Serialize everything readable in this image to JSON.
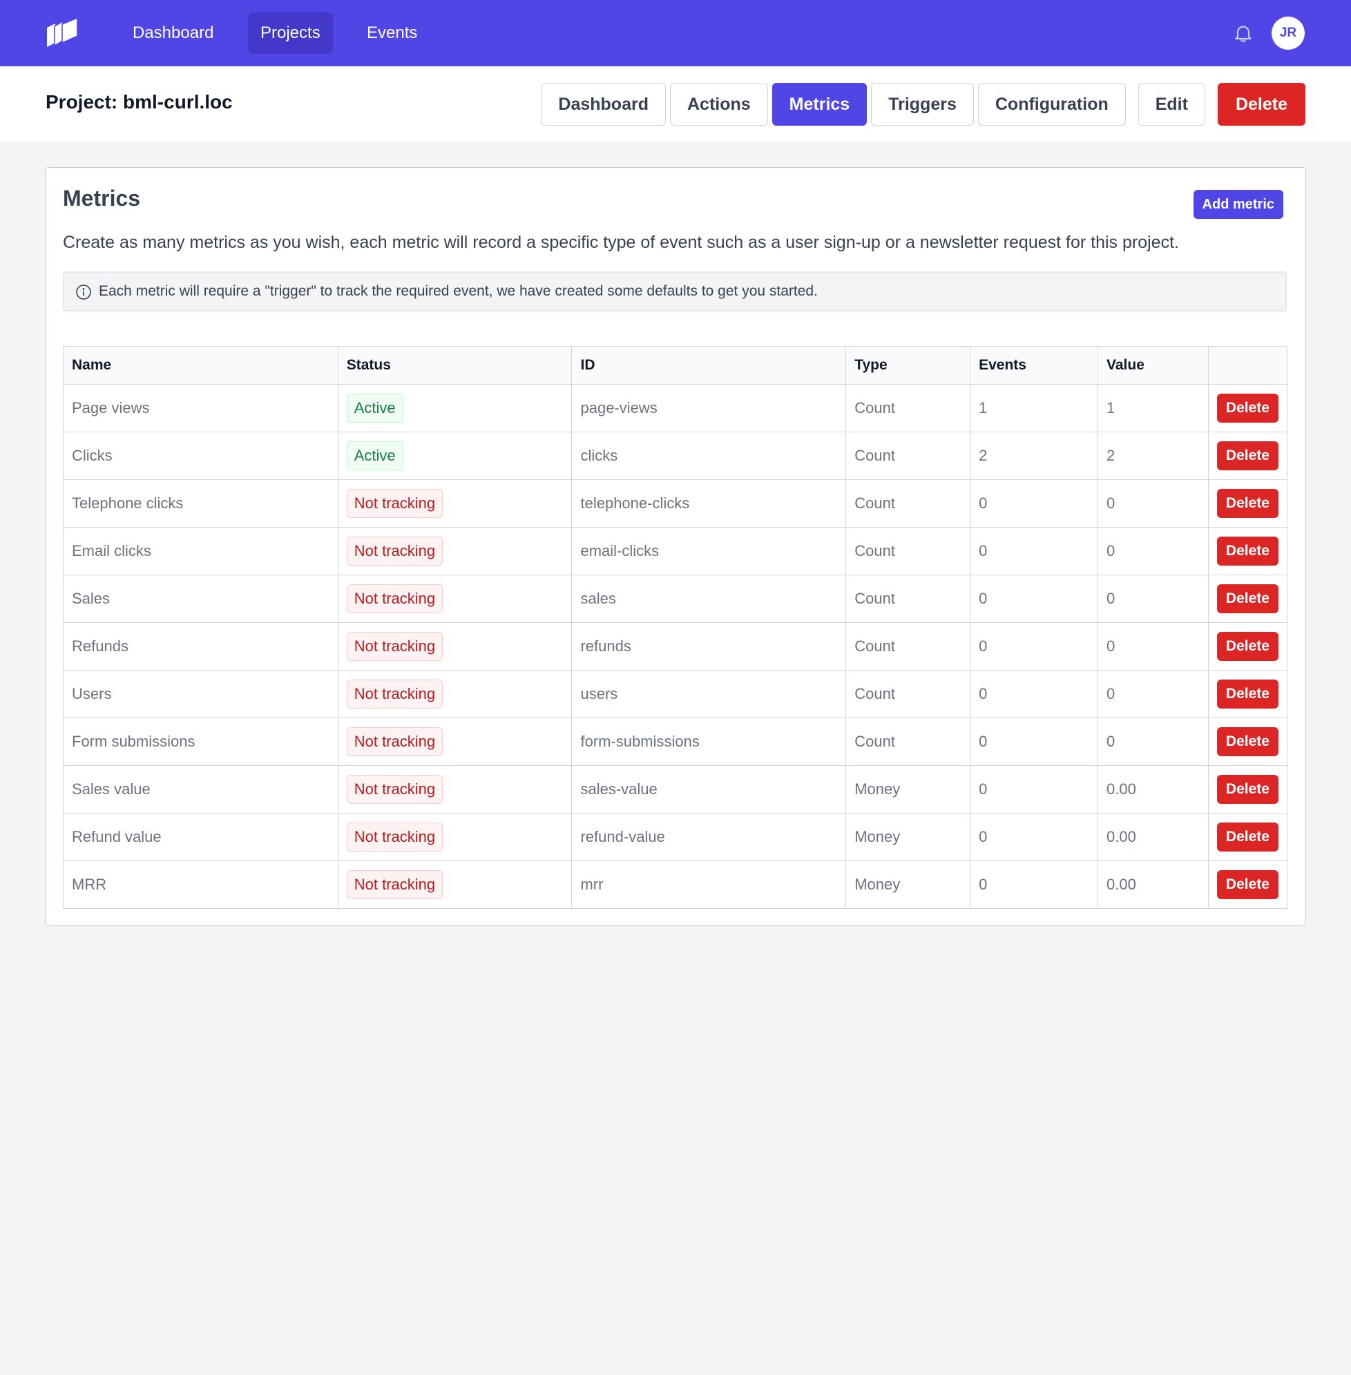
{
  "colors": {
    "brand": "#4f46e5",
    "brand_dark": "#4338ca",
    "danger": "#dc2626",
    "success": "#15803d"
  },
  "topnav": {
    "logo_icon": "stacked-pages-logo-icon",
    "links": [
      {
        "label": "Dashboard",
        "active": false
      },
      {
        "label": "Projects",
        "active": true
      },
      {
        "label": "Events",
        "active": false
      }
    ],
    "notifications_icon": "bell-icon",
    "avatar_initials": "JR"
  },
  "subheader": {
    "title": "Project: bml-curl.loc",
    "tabs": [
      {
        "label": "Dashboard",
        "active": false
      },
      {
        "label": "Actions",
        "active": false
      },
      {
        "label": "Metrics",
        "active": true
      },
      {
        "label": "Triggers",
        "active": false
      },
      {
        "label": "Configuration",
        "active": false
      }
    ],
    "edit_label": "Edit",
    "delete_label": "Delete"
  },
  "card": {
    "title": "Metrics",
    "add_button": "Add metric",
    "description": "Create as many metrics as you wish, each metric will record a specific type of event such as a user sign-up or a newsletter request for this project.",
    "info_icon": "info-circle-icon",
    "info_text": "Each metric will require a \"trigger\" to track the required event, we have created some defaults to get you started."
  },
  "table": {
    "headers": [
      "Name",
      "Status",
      "ID",
      "Type",
      "Events",
      "Value",
      ""
    ],
    "delete_label": "Delete",
    "rows": [
      {
        "name": "Page views",
        "status": "Active",
        "status_kind": "active",
        "id": "page-views",
        "type": "Count",
        "events": "1",
        "value": "1"
      },
      {
        "name": "Clicks",
        "status": "Active",
        "status_kind": "active",
        "id": "clicks",
        "type": "Count",
        "events": "2",
        "value": "2"
      },
      {
        "name": "Telephone clicks",
        "status": "Not tracking",
        "status_kind": "inactive",
        "id": "telephone-clicks",
        "type": "Count",
        "events": "0",
        "value": "0"
      },
      {
        "name": "Email clicks",
        "status": "Not tracking",
        "status_kind": "inactive",
        "id": "email-clicks",
        "type": "Count",
        "events": "0",
        "value": "0"
      },
      {
        "name": "Sales",
        "status": "Not tracking",
        "status_kind": "inactive",
        "id": "sales",
        "type": "Count",
        "events": "0",
        "value": "0"
      },
      {
        "name": "Refunds",
        "status": "Not tracking",
        "status_kind": "inactive",
        "id": "refunds",
        "type": "Count",
        "events": "0",
        "value": "0"
      },
      {
        "name": "Users",
        "status": "Not tracking",
        "status_kind": "inactive",
        "id": "users",
        "type": "Count",
        "events": "0",
        "value": "0"
      },
      {
        "name": "Form submissions",
        "status": "Not tracking",
        "status_kind": "inactive",
        "id": "form-submissions",
        "type": "Count",
        "events": "0",
        "value": "0"
      },
      {
        "name": "Sales value",
        "status": "Not tracking",
        "status_kind": "inactive",
        "id": "sales-value",
        "type": "Money",
        "events": "0",
        "value": "0.00"
      },
      {
        "name": "Refund value",
        "status": "Not tracking",
        "status_kind": "inactive",
        "id": "refund-value",
        "type": "Money",
        "events": "0",
        "value": "0.00"
      },
      {
        "name": "MRR",
        "status": "Not tracking",
        "status_kind": "inactive",
        "id": "mrr",
        "type": "Money",
        "events": "0",
        "value": "0.00"
      }
    ]
  }
}
